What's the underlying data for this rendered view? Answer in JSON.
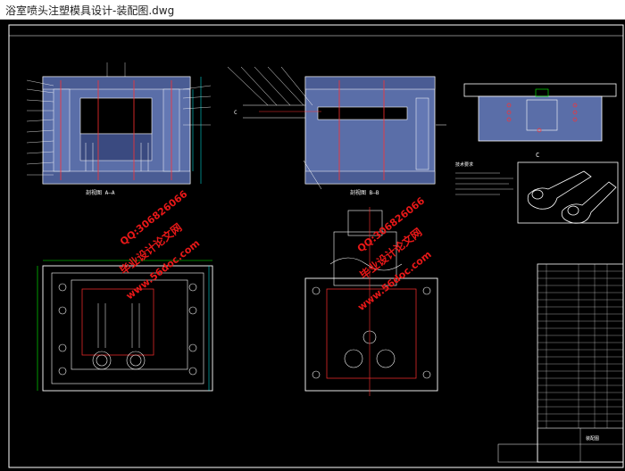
{
  "window": {
    "title": "浴室喷头注塑模具设计-装配图.dwg"
  },
  "drawing": {
    "section_a_label": "剖视图 A—A",
    "section_b_label": "剖视图 B—B",
    "tech_title": "技术要求",
    "view_letter": "C",
    "title_block_name": "装配图",
    "watermarks": {
      "site": "www.56doc.com",
      "qq": "QQ:306826066",
      "brand": "毕业设计论文网"
    }
  },
  "colors": {
    "background": "#000000",
    "cad_white": "#ffffff",
    "cad_blue": "#5a6ea8",
    "cad_red": "#ff3030",
    "cad_green": "#00ff00",
    "cad_cyan": "#00ffff",
    "cad_yellow": "#ffff00",
    "watermark_red": "#e81818"
  }
}
